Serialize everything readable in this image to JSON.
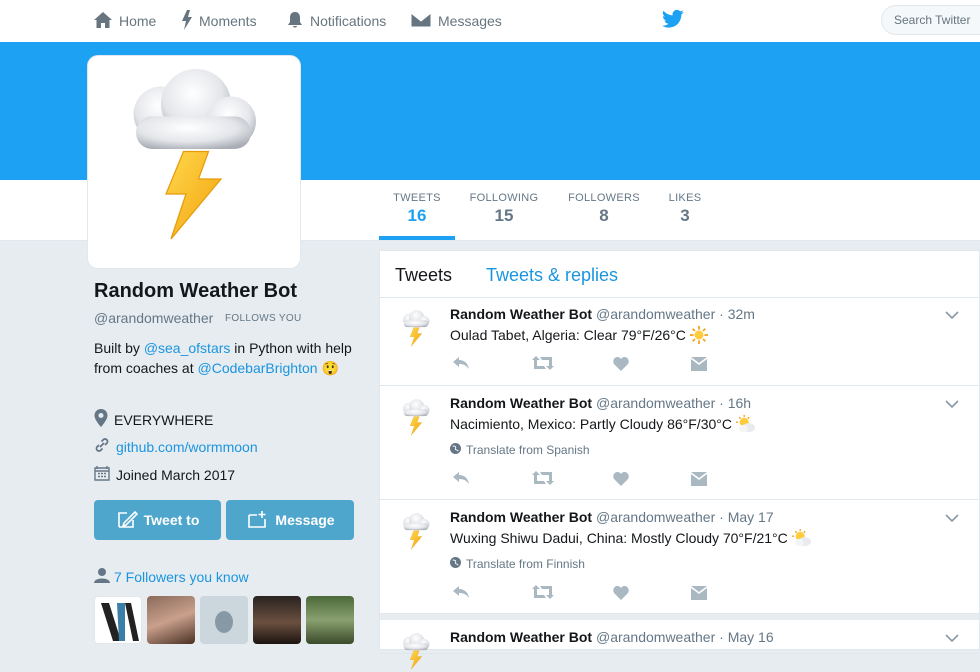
{
  "nav": {
    "home": "Home",
    "moments": "Moments",
    "notifications": "Notifications",
    "messages": "Messages",
    "search_placeholder": "Search Twitter"
  },
  "colors": {
    "brand_blue": "#1da1f2",
    "link_blue": "#1b95e0",
    "button_blue": "#4fa6cd"
  },
  "stats": [
    {
      "label": "TWEETS",
      "value": "16",
      "active": true
    },
    {
      "label": "FOLLOWING",
      "value": "15"
    },
    {
      "label": "FOLLOWERS",
      "value": "8"
    },
    {
      "label": "LIKES",
      "value": "3"
    }
  ],
  "profile": {
    "name": "Random Weather Bot",
    "handle": "@arandomweather",
    "follows_you": "FOLLOWS YOU",
    "bio": {
      "t1": "Built by ",
      "l1": "@sea_ofstars",
      "t2": " in Python with help from coaches at ",
      "l2": "@CodebarBrighton",
      "emoji": "😲"
    },
    "location": "EVERYWHERE",
    "website": "github.com/wormmoon",
    "joined": "Joined March 2017",
    "tweet_to": "Tweet to",
    "message": "Message",
    "followers_you_know": "7 Followers you know"
  },
  "timeline": {
    "tab_tweets": "Tweets",
    "tab_replies": "Tweets & replies",
    "tweets": [
      {
        "name": "Random Weather Bot",
        "handle": "@arandomweather",
        "dot": "·",
        "time": "32m",
        "text": "Oulad Tabet, Algeria: Clear 79°F/26°C",
        "icon": "sun-icon"
      },
      {
        "name": "Random Weather Bot",
        "handle": "@arandomweather",
        "dot": "·",
        "time": "16h",
        "text": "Nacimiento, Mexico: Partly Cloudy 86°F/30°C",
        "icon": "partly-cloudy-icon",
        "translate": "Translate from Spanish"
      },
      {
        "name": "Random Weather Bot",
        "handle": "@arandomweather",
        "dot": "·",
        "time": "May 17",
        "text": "Wuxing Shiwu Dadui, China: Mostly Cloudy 70°F/21°C",
        "icon": "partly-cloudy-icon",
        "translate": "Translate from Finnish"
      },
      {
        "name": "Random Weather Bot",
        "handle": "@arandomweather",
        "dot": "·",
        "time": "May 16"
      }
    ]
  }
}
